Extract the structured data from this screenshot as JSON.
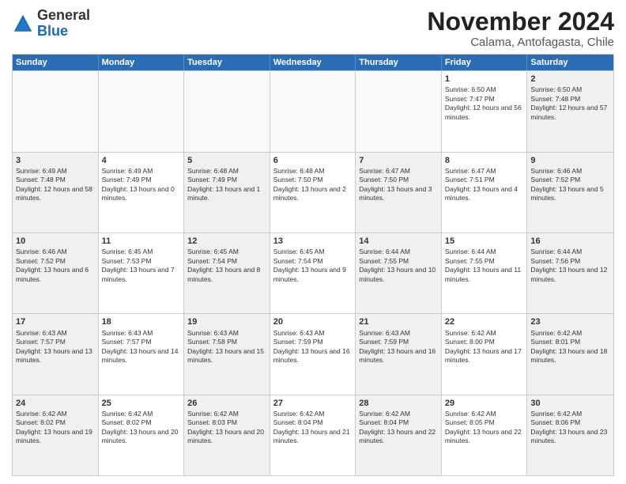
{
  "logo": {
    "general": "General",
    "blue": "Blue"
  },
  "header": {
    "month": "November 2024",
    "location": "Calama, Antofagasta, Chile"
  },
  "days": [
    "Sunday",
    "Monday",
    "Tuesday",
    "Wednesday",
    "Thursday",
    "Friday",
    "Saturday"
  ],
  "rows": [
    [
      {
        "day": "",
        "text": ""
      },
      {
        "day": "",
        "text": ""
      },
      {
        "day": "",
        "text": ""
      },
      {
        "day": "",
        "text": ""
      },
      {
        "day": "",
        "text": ""
      },
      {
        "day": "1",
        "text": "Sunrise: 6:50 AM\nSunset: 7:47 PM\nDaylight: 12 hours and 56 minutes."
      },
      {
        "day": "2",
        "text": "Sunrise: 6:50 AM\nSunset: 7:48 PM\nDaylight: 12 hours and 57 minutes."
      }
    ],
    [
      {
        "day": "3",
        "text": "Sunrise: 6:49 AM\nSunset: 7:48 PM\nDaylight: 12 hours and 58 minutes."
      },
      {
        "day": "4",
        "text": "Sunrise: 6:49 AM\nSunset: 7:49 PM\nDaylight: 13 hours and 0 minutes."
      },
      {
        "day": "5",
        "text": "Sunrise: 6:48 AM\nSunset: 7:49 PM\nDaylight: 13 hours and 1 minute."
      },
      {
        "day": "6",
        "text": "Sunrise: 6:48 AM\nSunset: 7:50 PM\nDaylight: 13 hours and 2 minutes."
      },
      {
        "day": "7",
        "text": "Sunrise: 6:47 AM\nSunset: 7:50 PM\nDaylight: 13 hours and 3 minutes."
      },
      {
        "day": "8",
        "text": "Sunrise: 6:47 AM\nSunset: 7:51 PM\nDaylight: 13 hours and 4 minutes."
      },
      {
        "day": "9",
        "text": "Sunrise: 6:46 AM\nSunset: 7:52 PM\nDaylight: 13 hours and 5 minutes."
      }
    ],
    [
      {
        "day": "10",
        "text": "Sunrise: 6:46 AM\nSunset: 7:52 PM\nDaylight: 13 hours and 6 minutes."
      },
      {
        "day": "11",
        "text": "Sunrise: 6:45 AM\nSunset: 7:53 PM\nDaylight: 13 hours and 7 minutes."
      },
      {
        "day": "12",
        "text": "Sunrise: 6:45 AM\nSunset: 7:54 PM\nDaylight: 13 hours and 8 minutes."
      },
      {
        "day": "13",
        "text": "Sunrise: 6:45 AM\nSunset: 7:54 PM\nDaylight: 13 hours and 9 minutes."
      },
      {
        "day": "14",
        "text": "Sunrise: 6:44 AM\nSunset: 7:55 PM\nDaylight: 13 hours and 10 minutes."
      },
      {
        "day": "15",
        "text": "Sunrise: 6:44 AM\nSunset: 7:55 PM\nDaylight: 13 hours and 11 minutes."
      },
      {
        "day": "16",
        "text": "Sunrise: 6:44 AM\nSunset: 7:56 PM\nDaylight: 13 hours and 12 minutes."
      }
    ],
    [
      {
        "day": "17",
        "text": "Sunrise: 6:43 AM\nSunset: 7:57 PM\nDaylight: 13 hours and 13 minutes."
      },
      {
        "day": "18",
        "text": "Sunrise: 6:43 AM\nSunset: 7:57 PM\nDaylight: 13 hours and 14 minutes."
      },
      {
        "day": "19",
        "text": "Sunrise: 6:43 AM\nSunset: 7:58 PM\nDaylight: 13 hours and 15 minutes."
      },
      {
        "day": "20",
        "text": "Sunrise: 6:43 AM\nSunset: 7:59 PM\nDaylight: 13 hours and 16 minutes."
      },
      {
        "day": "21",
        "text": "Sunrise: 6:43 AM\nSunset: 7:59 PM\nDaylight: 13 hours and 16 minutes."
      },
      {
        "day": "22",
        "text": "Sunrise: 6:42 AM\nSunset: 8:00 PM\nDaylight: 13 hours and 17 minutes."
      },
      {
        "day": "23",
        "text": "Sunrise: 6:42 AM\nSunset: 8:01 PM\nDaylight: 13 hours and 18 minutes."
      }
    ],
    [
      {
        "day": "24",
        "text": "Sunrise: 6:42 AM\nSunset: 8:02 PM\nDaylight: 13 hours and 19 minutes."
      },
      {
        "day": "25",
        "text": "Sunrise: 6:42 AM\nSunset: 8:02 PM\nDaylight: 13 hours and 20 minutes."
      },
      {
        "day": "26",
        "text": "Sunrise: 6:42 AM\nSunset: 8:03 PM\nDaylight: 13 hours and 20 minutes."
      },
      {
        "day": "27",
        "text": "Sunrise: 6:42 AM\nSunset: 8:04 PM\nDaylight: 13 hours and 21 minutes."
      },
      {
        "day": "28",
        "text": "Sunrise: 6:42 AM\nSunset: 8:04 PM\nDaylight: 13 hours and 22 minutes."
      },
      {
        "day": "29",
        "text": "Sunrise: 6:42 AM\nSunset: 8:05 PM\nDaylight: 13 hours and 22 minutes."
      },
      {
        "day": "30",
        "text": "Sunrise: 6:42 AM\nSunset: 8:06 PM\nDaylight: 13 hours and 23 minutes."
      }
    ]
  ]
}
